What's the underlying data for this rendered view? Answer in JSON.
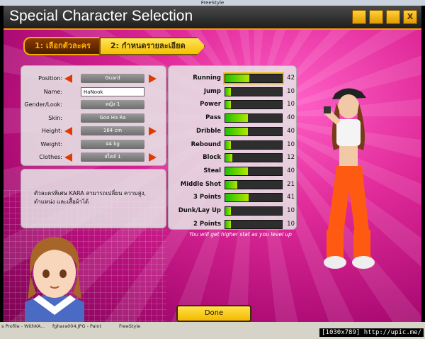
{
  "window": {
    "title": "FreeStyle"
  },
  "header": {
    "title": "Special Character Selection",
    "buttons": [
      "",
      "",
      "",
      "X"
    ]
  },
  "steps": [
    {
      "label": "1: เลือกตัวละคร"
    },
    {
      "label": "2: กำหนดรายละเอียด"
    }
  ],
  "form": {
    "rows": [
      {
        "label": "Position:",
        "value": "Guard",
        "arrows": true,
        "input": false
      },
      {
        "label": "Name:",
        "value": "HaNook",
        "arrows": false,
        "input": true
      },
      {
        "label": "Gender/Look:",
        "value": "หญิง 1",
        "arrows": false,
        "input": false
      },
      {
        "label": "Skin:",
        "value": "Goo Ha Ra",
        "arrows": false,
        "input": false
      },
      {
        "label": "Height:",
        "value": "164 cm",
        "arrows": true,
        "input": false
      },
      {
        "label": "Weight:",
        "value": "44 kg",
        "arrows": false,
        "input": false
      },
      {
        "label": "Clothes:",
        "value": "สไตล์ 1",
        "arrows": true,
        "input": false
      }
    ]
  },
  "description": "ตัวละครพิเศษ KARA สามารถเปลี่ยน ความสูง, ตำแหน่ง และเสื้อผ้าได้",
  "stats": [
    {
      "name": "Running",
      "value": 42
    },
    {
      "name": "Jump",
      "value": 10
    },
    {
      "name": "Power",
      "value": 10
    },
    {
      "name": "Pass",
      "value": 40
    },
    {
      "name": "Dribble",
      "value": 40
    },
    {
      "name": "Rebound",
      "value": 10
    },
    {
      "name": "Block",
      "value": 12
    },
    {
      "name": "Steal",
      "value": 40
    },
    {
      "name": "Middle Shot",
      "value": 21
    },
    {
      "name": "3 Points",
      "value": 41
    },
    {
      "name": "Dunk/Lay Up",
      "value": 10
    },
    {
      "name": "2 Points",
      "value": 10
    }
  ],
  "stat_max": 100,
  "note": "You will get higher stat as you level up",
  "done_label": "Done",
  "taskbar": {
    "items": [
      "s Profile - WithKA...",
      "fghara004.JPG - Paint",
      "FreeStyle"
    ],
    "stamp": "[1030x789] http://upic.me/"
  },
  "colors": {
    "accent": "#ff9900",
    "bar_fill": "#8fd400",
    "arrow": "#e03a00"
  }
}
